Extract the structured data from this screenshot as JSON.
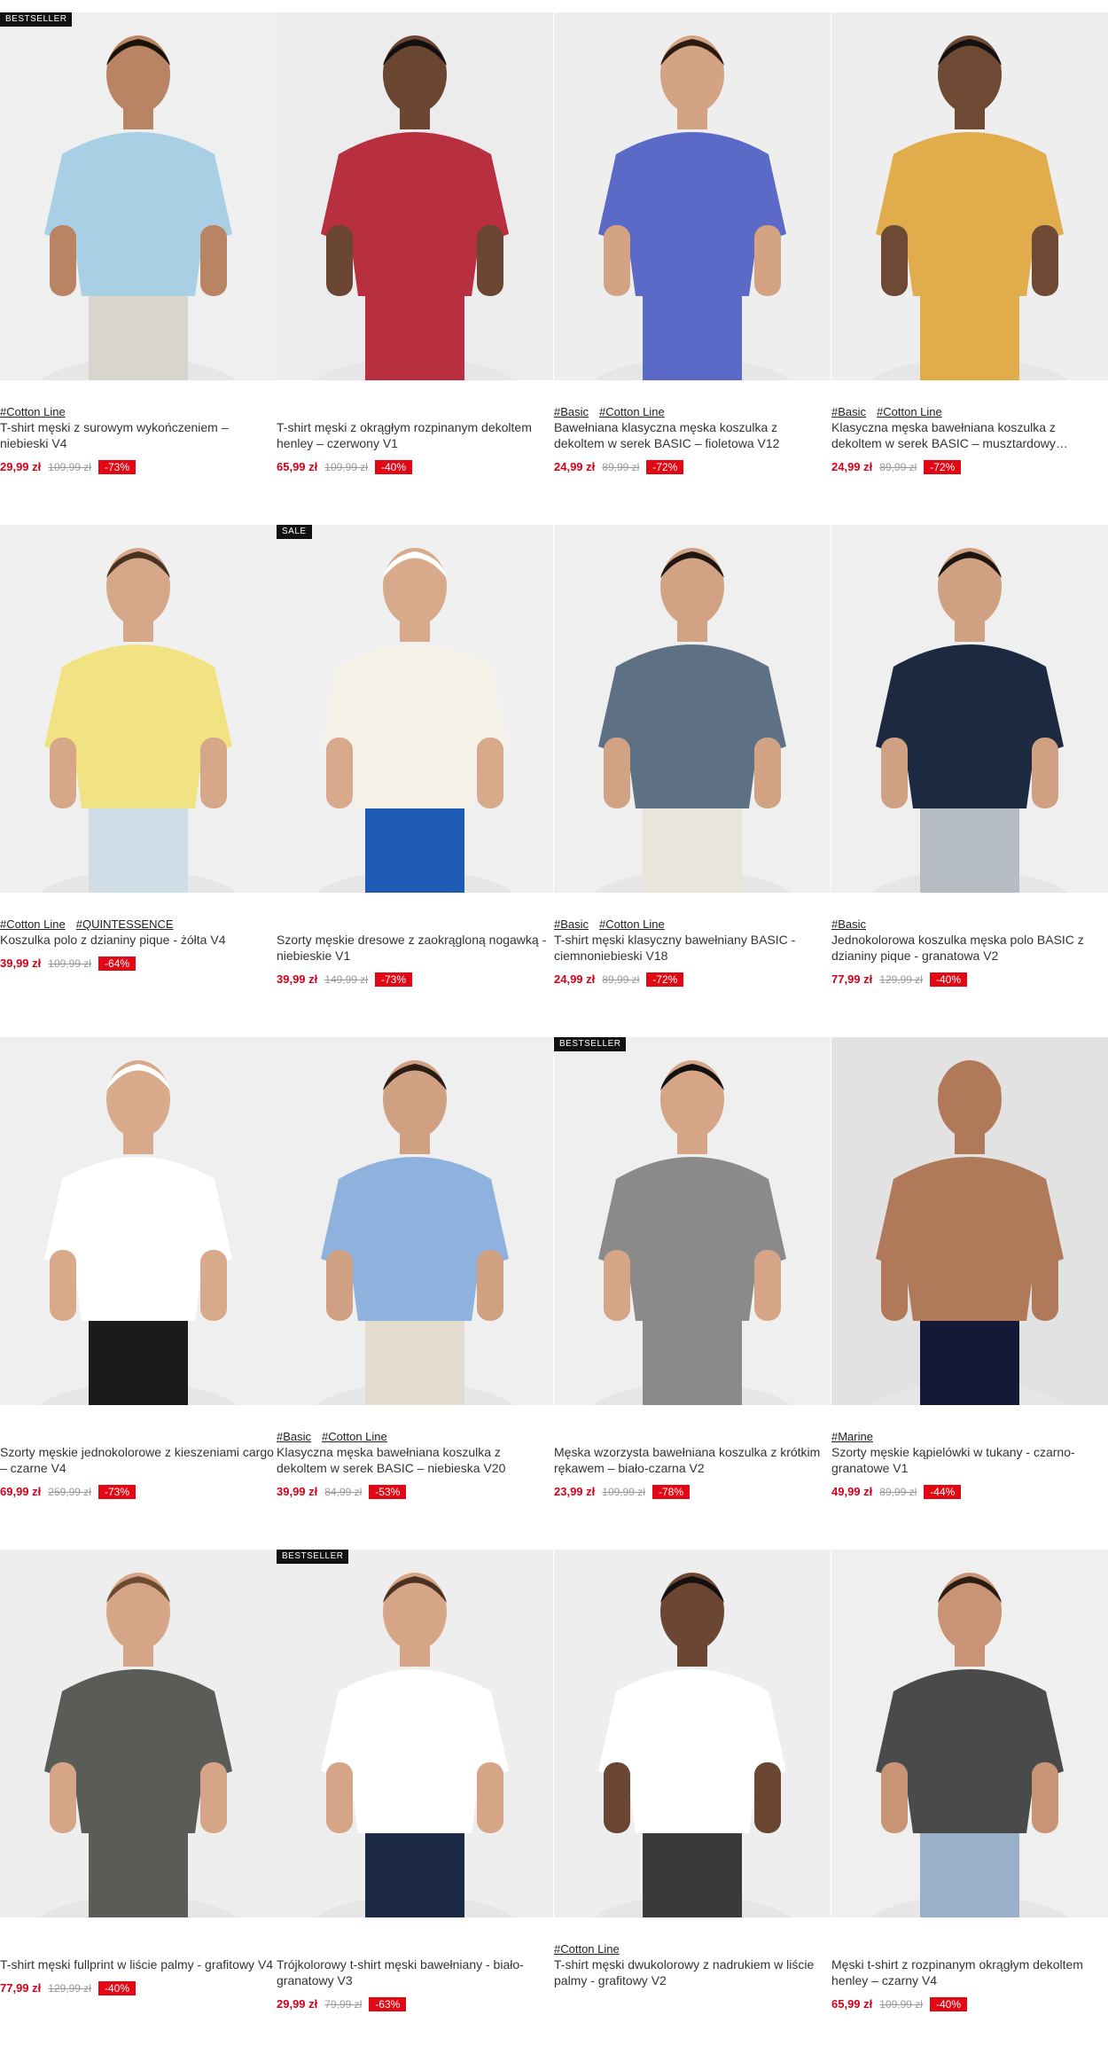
{
  "products": [
    {
      "badge": "BESTSELLER",
      "tags": [
        "#Cotton Line"
      ],
      "title": "T-shirt męski z surowym wykończeniem – niebieski V4",
      "price": "29,99 zł",
      "old_price": "109,99 zł",
      "discount": "-73%",
      "skin": "#b98463",
      "hair": "#1a1208",
      "shirt": "#a9cfe4",
      "pants": "#d9d4cc",
      "bg": "#efefef"
    },
    {
      "badge": "",
      "tags": [],
      "title": "T-shirt męski z okrągłym rozpinanym dekoltem henley – czerwony V1",
      "price": "65,99 zł",
      "old_price": "109,99 zł",
      "discount": "-40%",
      "skin": "#6b4632",
      "hair": "#141010",
      "shirt": "#b8303f",
      "pants": "#b8303f",
      "bg": "#ececec"
    },
    {
      "badge": "",
      "tags": [
        "#Basic",
        "#Cotton Line"
      ],
      "title": "Bawełniana klasyczna męska koszulka z dekoltem w serek BASIC – fioletowa V12",
      "price": "24,99 zł",
      "old_price": "89,99 zł",
      "discount": "-72%",
      "skin": "#d3a384",
      "hair": "#2a1a10",
      "shirt": "#5a6ac6",
      "pants": "#5a6ac6",
      "bg": "#eeeeee"
    },
    {
      "badge": "",
      "tags": [
        "#Basic",
        "#Cotton Line"
      ],
      "title": "Klasyczna męska bawełniana koszulka z dekoltem w serek BASIC – musztardowy…",
      "price": "24,99 zł",
      "old_price": "89,99 zł",
      "discount": "-72%",
      "skin": "#6e4a35",
      "hair": "#151010",
      "shirt": "#e0ac4c",
      "pants": "#e0ac4c",
      "bg": "#eeeeee"
    },
    {
      "badge": "",
      "tags": [
        "#Cotton Line",
        "#QUINTESSENCE"
      ],
      "title": "Koszulka polo z dzianiny pique - żółta V4",
      "price": "39,99 zł",
      "old_price": "109,99 zł",
      "discount": "-64%",
      "skin": "#d6a889",
      "hair": "#4a3222",
      "shirt": "#f1e383",
      "pants": "#cfdde8",
      "bg": "#f0f0f0"
    },
    {
      "badge": "SALE",
      "tags": [],
      "title": "Szorty męskie dresowe z zaokrągloną nogawką - niebieskie V1",
      "price": "39,99 zł",
      "old_price": "149,99 zł",
      "discount": "-73%",
      "skin": "#d8a98a",
      "hair": "#ffffff",
      "shirt": "#f6f2e8",
      "pants": "#1e5bb5",
      "bg": "#f0f0f0"
    },
    {
      "badge": "",
      "tags": [
        "#Basic",
        "#Cotton Line"
      ],
      "title": "T-shirt męski klasyczny bawełniany BASIC - ciemnoniebieski V18",
      "price": "24,99 zł",
      "old_price": "89,99 zł",
      "discount": "-72%",
      "skin": "#d1a284",
      "hair": "#201510",
      "shirt": "#5e7083",
      "pants": "#e9e5da",
      "bg": "#efefef"
    },
    {
      "badge": "",
      "tags": [
        "#Basic"
      ],
      "title": "Jednokolorowa koszulka męska polo BASIC z dzianiny pique - granatowa V2",
      "price": "77,99 zł",
      "old_price": "129,99 zł",
      "discount": "-40%",
      "skin": "#d0a083",
      "hair": "#1c1410",
      "shirt": "#1c2940",
      "pants": "#b6bcc4",
      "bg": "#efefef"
    },
    {
      "badge": "",
      "tags": [],
      "title": "Szorty męskie jednokolorowe z kieszeniami cargo – czarne V4",
      "price": "69,99 zł",
      "old_price": "259,99 zł",
      "discount": "-73%",
      "skin": "#d8a98a",
      "hair": "#ffffff",
      "shirt": "#ffffff",
      "pants": "#1b1b1b",
      "bg": "#efefef"
    },
    {
      "badge": "",
      "tags": [
        "#Basic",
        "#Cotton Line"
      ],
      "title": "Klasyczna męska bawełniana koszulka z dekoltem w serek BASIC – niebieska V20",
      "price": "39,99 zł",
      "old_price": "84,99 zł",
      "discount": "-53%",
      "skin": "#d0a083",
      "hair": "#2a1c12",
      "shirt": "#8fb1de",
      "pants": "#e3dccf",
      "bg": "#efefef"
    },
    {
      "badge": "BESTSELLER",
      "tags": [],
      "title": "Męska wzorzysta bawełniana koszulka z krótkim rękawem – biało-czarna V2",
      "price": "23,99 zł",
      "old_price": "109,99 zł",
      "discount": "-78%",
      "skin": "#d6a588",
      "hair": "#111111",
      "shirt": "#8a8a8a",
      "pants": "#8a8a8a",
      "bg": "#efefef"
    },
    {
      "badge": "",
      "tags": [
        "#Marine"
      ],
      "title": "Szorty męskie kąpielówki w tukany - czarno-granatowe V1",
      "price": "49,99 zł",
      "old_price": "89,99 zł",
      "discount": "-44%",
      "skin": "#b07a5a",
      "hair": "#b07a5a",
      "shirt": "#b07a5a",
      "pants": "#141a35",
      "bg": "#e2e2e2"
    },
    {
      "badge": "",
      "tags": [],
      "title": "T-shirt męski fullprint w liście palmy - grafitowy V4",
      "price": "77,99 zł",
      "old_price": "129,99 zł",
      "discount": "-40%",
      "skin": "#d6a588",
      "hair": "#6b4a30",
      "shirt": "#5a5c58",
      "pants": "#5a5c58",
      "bg": "#eeeeee"
    },
    {
      "badge": "BESTSELLER",
      "tags": [],
      "title": "Trójkolorowy t-shirt męski bawełniany - biało-granatowy V3",
      "price": "29,99 zł",
      "old_price": "79,99 zł",
      "discount": "-63%",
      "skin": "#d6a588",
      "hair": "#4a3220",
      "shirt": "#ffffff",
      "pants": "#1d2a44",
      "bg": "#eeeeee"
    },
    {
      "badge": "",
      "tags": [
        "#Cotton Line"
      ],
      "title": "T-shirt męski dwukolorowy z nadrukiem w liście palmy - grafitowy V2",
      "price": "",
      "old_price": "",
      "discount": "",
      "skin": "#6b4632",
      "hair": "#141010",
      "shirt": "#ffffff",
      "pants": "#3a3a3a",
      "bg": "#eeeeee"
    },
    {
      "badge": "",
      "tags": [],
      "title": "Męski t-shirt z rozpinanym okrągłym dekoltem henley – czarny V4",
      "price": "65,99 zł",
      "old_price": "109,99 zł",
      "discount": "-40%",
      "skin": "#c99475",
      "hair": "#2a1c12",
      "shirt": "#4a4a4a",
      "pants": "#9ab0c8",
      "bg": "#efefef"
    }
  ]
}
